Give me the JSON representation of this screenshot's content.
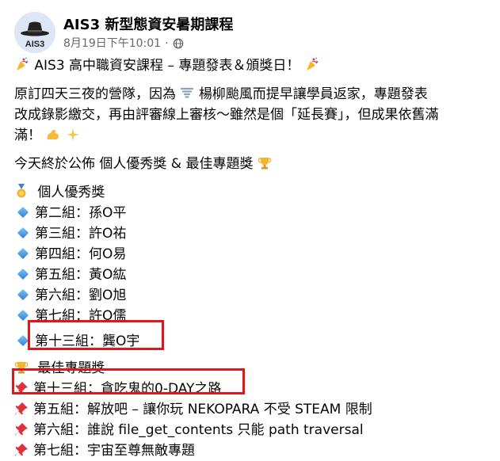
{
  "post_header": {
    "page_name": "AIS3 新型態資安暑期課程",
    "timestamp": "8月19日下午10:01",
    "separator": "·",
    "avatar_text": "AIS3"
  },
  "post_body": {
    "title": "AIS3 高中職資安課程 – 專題發表＆頒獎日！",
    "para1_line1": "原訂四天三夜的營隊，因為",
    "para1_line1b": "楊柳颱風而提早讓學員返家，專題發表",
    "para1_line2": "改成錄影繳交，再由評審線上審核～雖然是個「延長賽」，但成果依舊滿",
    "para1_line3": "滿！",
    "announce": "今天終於公佈 個人優秀獎 & 最佳專題獎",
    "individual_heading": "個人優秀獎",
    "individual_awards": [
      "第二組：孫O平",
      "第三組：許O祐",
      "第四組：何O易",
      "第五組：黃O紘",
      "第六組：劉O旭",
      "第七組：許O儒",
      "第十三組：龔O宇"
    ],
    "project_heading": "最佳專題獎",
    "project_awards": [
      "第十三組：貪吃鬼的0-DAY之路",
      "第五組：解放吧 – 讓你玩 NEKOPARA 不受 STEAM 限制",
      "第六組：誰說 file_get_contents 只能 path traversal",
      "第七組：宇宙至尊無敵專題"
    ]
  },
  "colors": {
    "highlight_box": "#e0161a",
    "meta_text": "#65676b",
    "text": "#050505"
  },
  "icons": {
    "title_prefix": "party-popper-icon",
    "title_suffix": "party-popper-icon",
    "typhoon": "tornado-icon",
    "flex": "flexed-biceps-icon",
    "sparkles": "sparkles-icon",
    "trophy": "trophy-icon",
    "medal": "medal-icon",
    "bullet": "blue-diamond-icon",
    "pin": "pushpin-icon"
  }
}
